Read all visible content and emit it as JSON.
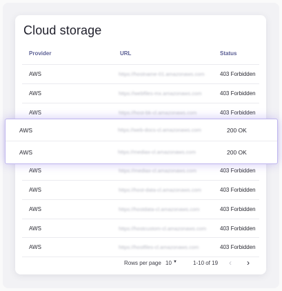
{
  "title": "Cloud storage",
  "columns": {
    "provider": "Provider",
    "url": "URL",
    "status": "Status"
  },
  "rows": [
    {
      "provider": "AWS",
      "url": "https://hostname-01.amazonaws.com",
      "status": "403 Forbidden"
    },
    {
      "provider": "AWS",
      "url": "https://webfiles-mx.amazonaws.com",
      "status": "403 Forbidden"
    },
    {
      "provider": "AWS",
      "url": "https://host-bk-cl.amazonaws.com",
      "status": "403 Forbidden"
    },
    {
      "provider": "AWS",
      "url": "https://web-docs-cl.amazonaws.com",
      "status": "200 OK"
    },
    {
      "provider": "AWS",
      "url": "https://mediax-cl.amazonaws.com",
      "status": "200 OK"
    },
    {
      "provider": "AWS",
      "url": "https://mediax-cl.amazonaws.com",
      "status": "403 Forbidden"
    },
    {
      "provider": "AWS",
      "url": "https://host-data-cl.amazonaws.com",
      "status": "403 Forbidden"
    },
    {
      "provider": "AWS",
      "url": "https://hostdata-cl.amazonaws.com",
      "status": "403 Forbidden"
    },
    {
      "provider": "AWS",
      "url": "https://hostcustom-cl.amazonaws.com",
      "status": "403 Forbidden"
    },
    {
      "provider": "AWS",
      "url": "https://hostfiles-cl.amazonaws.com",
      "status": "403 Forbidden"
    }
  ],
  "footer": {
    "rows_per_page_label": "Rows per page",
    "rows_per_page_value": "10",
    "range": "1-10 of 19"
  },
  "icons": {
    "dropdown": "caret-down-icon",
    "prev": "chevron-left-icon",
    "next": "chevron-right-icon"
  },
  "colors": {
    "header_text": "#5b5f94",
    "highlight_border": "#bfb6ee",
    "highlight_glow": "#9682eb"
  }
}
